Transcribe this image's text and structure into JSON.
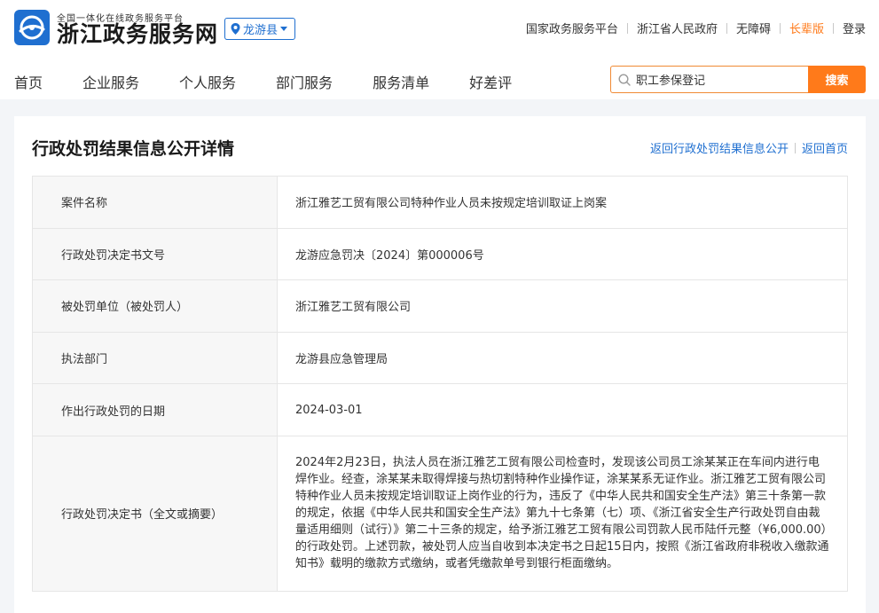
{
  "header": {
    "subtitle": "全国一体化在线政务服务平台",
    "title": "浙江政务服务网",
    "region": "龙游县",
    "links": [
      "国家政务服务平台",
      "浙江省人民政府",
      "无障碍",
      "长辈版",
      "登录"
    ]
  },
  "nav": {
    "items": [
      "首页",
      "企业服务",
      "个人服务",
      "部门服务",
      "服务清单",
      "好差评"
    ]
  },
  "search": {
    "value": "职工参保登记",
    "button": "搜索"
  },
  "page": {
    "title": "行政处罚结果信息公开详情",
    "link_back_list": "返回行政处罚结果信息公开",
    "link_home": "返回首页"
  },
  "detail": {
    "rows": [
      {
        "label": "案件名称",
        "value": "浙江雅艺工贸有限公司特种作业人员未按规定培训取证上岗案"
      },
      {
        "label": "行政处罚决定书文号",
        "value": "龙游应急罚决〔2024〕第000006号"
      },
      {
        "label": "被处罚单位（被处罚人）",
        "value": "浙江雅艺工贸有限公司"
      },
      {
        "label": "执法部门",
        "value": "龙游县应急管理局"
      },
      {
        "label": "作出行政处罚的日期",
        "value": "2024-03-01"
      },
      {
        "label": "行政处罚决定书（全文或摘要）",
        "value": "2024年2月23日，执法人员在浙江雅艺工贸有限公司检查时，发现该公司员工涂某某正在车间内进行电焊作业。经查，涂某某未取得焊接与热切割特种作业操作证，涂某某系无证作业。浙江雅艺工贸有限公司特种作业人员未按规定培训取证上岗作业的行为，违反了《中华人民共和国安全生产法》第三十条第一款的规定，依据《中华人民共和国安全生产法》第九十七条第（七）项、《浙江省安全生产行政处罚自由裁量适用细则（试行）》第二十三条的规定，给予浙江雅艺工贸有限公司罚款人民币陆仟元整（¥6,000.00）的行政处罚。上述罚款，被处罚人应当自收到本决定书之日起15日内，按照《浙江省政府非税收入缴款通知书》载明的缴款方式缴纳，或者凭缴款单号到银行柜面缴纳。"
      }
    ]
  },
  "colors": {
    "brand_blue": "#1f6fd0",
    "accent_orange": "#ff7a1a"
  }
}
